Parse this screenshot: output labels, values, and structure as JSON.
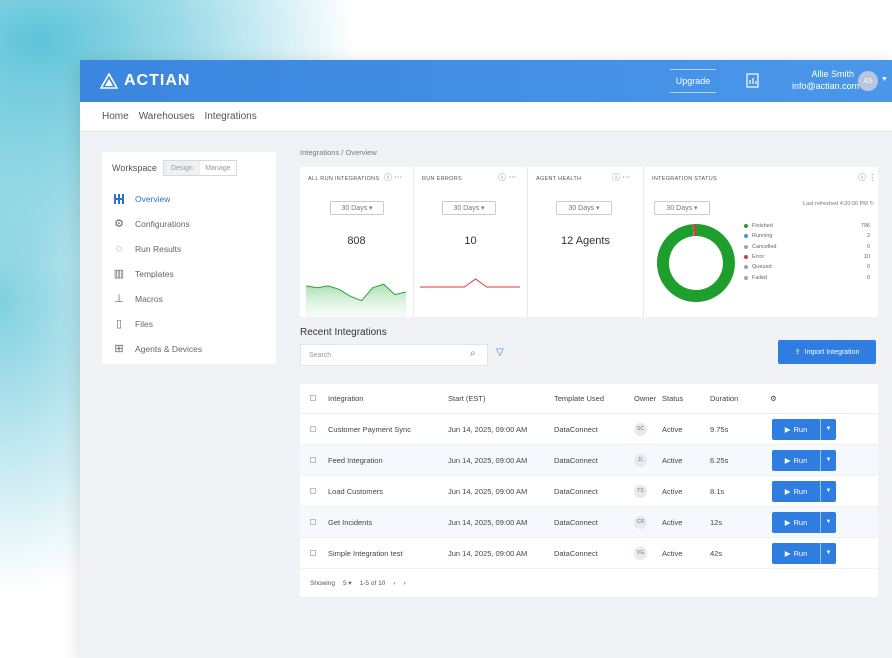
{
  "app": {
    "logo_text": "ACTIAN",
    "upgrade_label": "Upgrade",
    "user_name": "Allie Smith",
    "user_email": "info@actian.com",
    "user_initials": "AS"
  },
  "nav": {
    "items": [
      "Home",
      "Warehouses",
      "Integrations"
    ]
  },
  "sidebar": {
    "workspace_label": "Workspace",
    "toggle_options": [
      "Design",
      "Manage"
    ],
    "items": [
      {
        "label": "Overview",
        "icon": "overview-grid-icon"
      },
      {
        "label": "Configurations",
        "icon": "configurations-icon"
      },
      {
        "label": "Run Results",
        "icon": "run-results-icon"
      },
      {
        "label": "Templates",
        "icon": "templates-icon"
      },
      {
        "label": "Macros",
        "icon": "macros-icon"
      },
      {
        "label": "Files",
        "icon": "file-icon"
      },
      {
        "label": "Agents & Devices",
        "icon": "agents-devices-icon"
      }
    ]
  },
  "breadcrumb": {
    "parent": "Integrations",
    "separator": "/",
    "current": "Overview"
  },
  "cards": [
    {
      "title": "ALL RUN INTEGRATIONS",
      "range": "30 Days",
      "value": "808"
    },
    {
      "title": "RUN ERRORS",
      "range": "30 Days",
      "value": "10"
    },
    {
      "title": "AGENT HEALTH",
      "range": "30 Days",
      "value": "12 Agents"
    },
    {
      "title": "INTEGRATION STATUS",
      "range": "30 Days",
      "last_refresh": "Last refreshed 4:20:00 PM"
    }
  ],
  "status_legend": [
    {
      "label": "Finished",
      "count": "796",
      "color": "#1e9e2c"
    },
    {
      "label": "Running",
      "count": "2",
      "color": "#4a90e2"
    },
    {
      "label": "Cancelled",
      "count": "0",
      "color": "#9aa5b4"
    },
    {
      "label": "Error",
      "count": "10",
      "color": "#d93a3a"
    },
    {
      "label": "Queued",
      "count": "0",
      "color": "#9aa5b4"
    },
    {
      "label": "Failed",
      "count": "0",
      "color": "#9aa5b4"
    }
  ],
  "chart_data": [
    {
      "type": "area",
      "title": "",
      "series": [
        {
          "values": [
            38,
            40,
            38,
            42,
            50,
            55,
            40,
            36,
            48,
            45
          ]
        }
      ]
    },
    {
      "type": "line",
      "title": "",
      "series": [
        {
          "values": [
            10,
            10,
            10,
            10,
            10,
            18,
            10,
            10,
            10,
            10
          ]
        }
      ]
    },
    {
      "type": "pie",
      "title": "",
      "categories": [
        "Finished",
        "Running",
        "Error"
      ],
      "values": [
        796,
        2,
        10
      ]
    }
  ],
  "recent": {
    "title": "Recent Integrations",
    "search_placeholder": "Search",
    "import_label": "Import Integration",
    "columns": [
      "Integration",
      "Start (EST)",
      "Template Used",
      "Owner",
      "Status",
      "Duration"
    ],
    "rows": [
      {
        "name": "Customer Payment Sync",
        "start": "Jun 14, 2025, 09:00 AM",
        "template": "DataConnect",
        "owner": "SC",
        "status": "Active",
        "duration": "9.75s"
      },
      {
        "name": "Feed Integration",
        "start": "Jun 14, 2025, 09:00 AM",
        "template": "DataConnect",
        "owner": "JL",
        "status": "Active",
        "duration": "6.25s"
      },
      {
        "name": "Load Customers",
        "start": "Jun 14, 2025, 09:00 AM",
        "template": "DataConnect",
        "owner": "TS",
        "status": "Active",
        "duration": "8.1s"
      },
      {
        "name": "Get Incidents",
        "start": "Jun 14, 2025, 09:00 AM",
        "template": "DataConnect",
        "owner": "CR",
        "status": "Active",
        "duration": "12s"
      },
      {
        "name": "Simple Integration test",
        "start": "Jun 14, 2025, 09:00 AM",
        "template": "DataConnect",
        "owner": "VG",
        "status": "Active",
        "duration": "42s"
      }
    ],
    "run_label": "Run",
    "pager": {
      "showing_label": "Showing",
      "per_page": "5",
      "range_text": "1-5 of 10"
    }
  }
}
